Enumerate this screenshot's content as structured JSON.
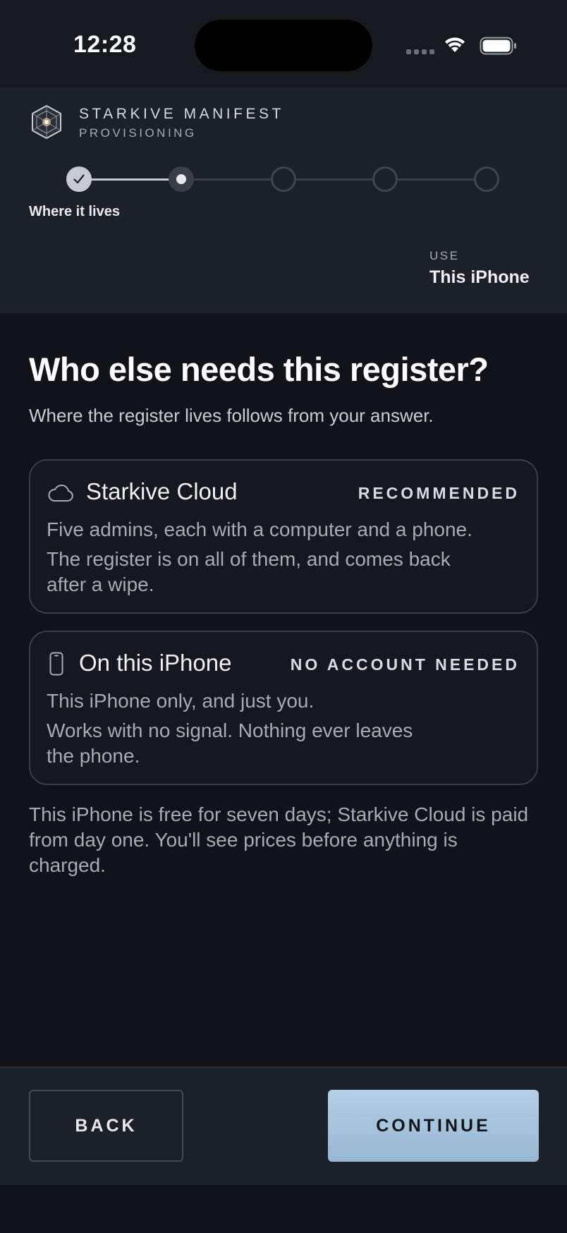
{
  "status_bar": {
    "time": "12:28",
    "icons": [
      "cellular-signal-icon",
      "wifi-icon",
      "battery-icon"
    ]
  },
  "header": {
    "brand_name": "STARKIVE MANIFEST",
    "brand_sub": "PROVISIONING",
    "logo_icon": "starkive-logo-icon",
    "stepper": {
      "total_steps": 5,
      "completed_steps": 1,
      "current_step": 2,
      "current_label": "Where it lives"
    },
    "use_kicker": "USE",
    "use_value": "This iPhone"
  },
  "main": {
    "title": "Who else needs this register?",
    "subtitle": "Where the register lives follows from your answer.",
    "options": [
      {
        "icon": "cloud-icon",
        "name": "Starkive Cloud",
        "tag": "RECOMMENDED",
        "line1": "Five admins, each with a computer and a phone.",
        "line2": "The register is on all of them, and comes back",
        "line3": "after a wipe."
      },
      {
        "icon": "iphone-icon",
        "name": "On this iPhone",
        "tag": "NO ACCOUNT NEEDED",
        "line1": "This iPhone only, and just you.",
        "line2": "Works with no signal. Nothing ever leaves",
        "line3": "the phone."
      }
    ],
    "footnote": "This iPhone is free for seven days; Starkive Cloud is paid from day one. You'll see prices before anything is charged."
  },
  "footer": {
    "back_label": "BACK",
    "continue_label": "CONTINUE"
  },
  "colors": {
    "background": "#111318",
    "header_bg": "#1c2029",
    "accent_button": "#a6c4de",
    "card_border": "#3a3e46"
  }
}
